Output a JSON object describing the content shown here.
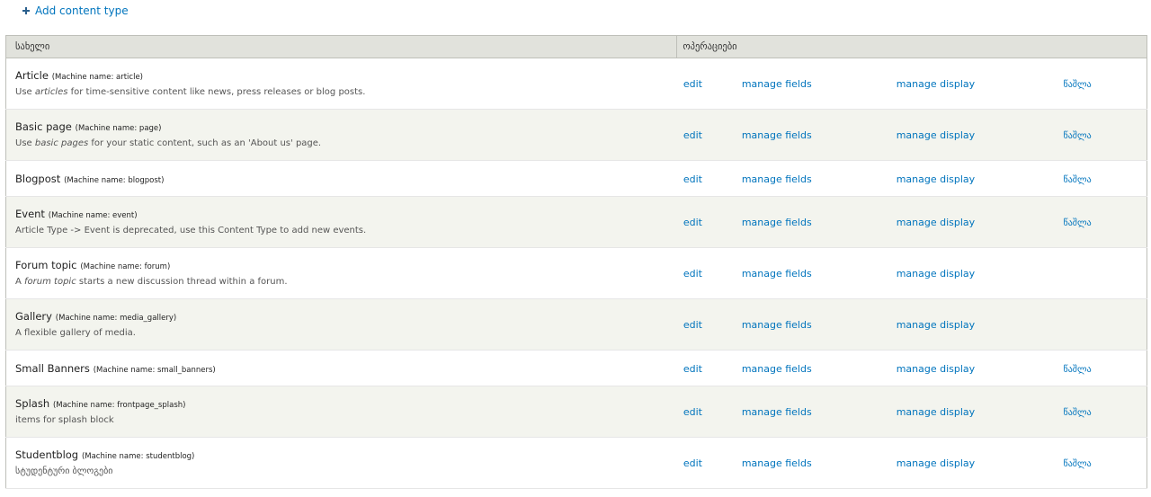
{
  "add_content_type": {
    "label": "Add content type"
  },
  "table": {
    "headers": {
      "name": "სახელი",
      "operations": "ოპერაციები"
    },
    "rows": [
      {
        "name": "Article",
        "machine_name": "(Machine name: article)",
        "desc_before": "Use ",
        "desc_em": "articles",
        "desc_after": " for time-sensitive content like news, press releases or blog posts.",
        "edit": "edit",
        "manage_fields": "manage fields",
        "manage_display": "manage display",
        "delete": "წაშლა"
      },
      {
        "name": "Basic page",
        "machine_name": "(Machine name: page)",
        "desc_before": "Use ",
        "desc_em": "basic pages",
        "desc_after": " for your static content, such as an 'About us' page.",
        "edit": "edit",
        "manage_fields": "manage fields",
        "manage_display": "manage display",
        "delete": "წაშლა"
      },
      {
        "name": "Blogpost",
        "machine_name": "(Machine name: blogpost)",
        "desc_before": "",
        "desc_em": "",
        "desc_after": "",
        "edit": "edit",
        "manage_fields": "manage fields",
        "manage_display": "manage display",
        "delete": "წაშლა"
      },
      {
        "name": "Event",
        "machine_name": "(Machine name: event)",
        "desc_before": "Article Type -> Event is deprecated, use this Content Type to add new events.",
        "desc_em": "",
        "desc_after": "",
        "edit": "edit",
        "manage_fields": "manage fields",
        "manage_display": "manage display",
        "delete": "წაშლა"
      },
      {
        "name": "Forum topic",
        "machine_name": "(Machine name: forum)",
        "desc_before": "A ",
        "desc_em": "forum topic",
        "desc_after": " starts a new discussion thread within a forum.",
        "edit": "edit",
        "manage_fields": "manage fields",
        "manage_display": "manage display",
        "delete": ""
      },
      {
        "name": "Gallery",
        "machine_name": "(Machine name: media_gallery)",
        "desc_before": "A flexible gallery of media.",
        "desc_em": "",
        "desc_after": "",
        "edit": "edit",
        "manage_fields": "manage fields",
        "manage_display": "manage display",
        "delete": ""
      },
      {
        "name": "Small Banners",
        "machine_name": "(Machine name: small_banners)",
        "desc_before": "",
        "desc_em": "",
        "desc_after": "",
        "edit": "edit",
        "manage_fields": "manage fields",
        "manage_display": "manage display",
        "delete": "წაშლა"
      },
      {
        "name": "Splash",
        "machine_name": "(Machine name: frontpage_splash)",
        "desc_before": "items for splash block",
        "desc_em": "",
        "desc_after": "",
        "edit": "edit",
        "manage_fields": "manage fields",
        "manage_display": "manage display",
        "delete": "წაშლა"
      },
      {
        "name": "Studentblog",
        "machine_name": "(Machine name: studentblog)",
        "desc_before": "სტუდენტური ბლოგები",
        "desc_em": "",
        "desc_after": "",
        "edit": "edit",
        "manage_fields": "manage fields",
        "manage_display": "manage display",
        "delete": "წაშლა"
      }
    ]
  },
  "colors": {
    "link": "#0074bd",
    "header_bg": "#e1e2dc",
    "even_row_bg": "#f3f4ee",
    "border": "#bebfb9"
  }
}
